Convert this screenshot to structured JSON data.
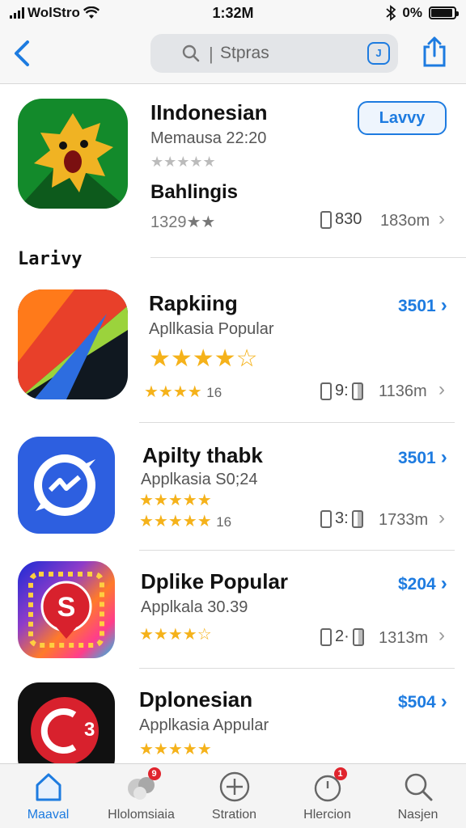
{
  "status_bar": {
    "carrier": "WolStro",
    "time": "1:32M",
    "battery": "0%",
    "battery_level": 0.92
  },
  "nav": {
    "search_text": "Stpras",
    "search_sep": "|",
    "clip_label": "J"
  },
  "featured": {
    "name": "IIndonesian",
    "subtitle": "Memausa 22:20",
    "stars": "★★★★★",
    "get_label": "Lavvy",
    "secondary_name": "Bahlingis",
    "rating": "1329★★",
    "count": "830",
    "size": "183om",
    "accent": "#1d7be0"
  },
  "section_title": "Larivy",
  "apps": [
    {
      "name": "Rapkiing",
      "subtitle": "Apllkasia Popular",
      "big_stars": "★★★★☆",
      "small_stars": "★★★★",
      "rating_count": "16",
      "count": "9:",
      "size": "1136m",
      "price": "3501"
    },
    {
      "name": "Apilty thabk",
      "subtitle": "Applkasia S0;24",
      "big_stars": "★★★★★",
      "small_stars": "★★★★★",
      "rating_count": "16",
      "count": "3:",
      "size": "1733m",
      "price": "3501"
    },
    {
      "name": "Dplike Popular",
      "subtitle": "Applkala 30.39",
      "big_stars": "",
      "small_stars": "★★★★☆",
      "rating_count": "",
      "count": "2·",
      "size": "1313m",
      "price": "$204"
    },
    {
      "name": "Dplonesian",
      "subtitle": "Applkasia Appular",
      "big_stars": "",
      "small_stars": "★★★★★",
      "rating_count": "",
      "count": "",
      "size": "",
      "price": "$504"
    }
  ],
  "tabs": [
    {
      "label": "Maaval",
      "icon": "home-icon",
      "active": true
    },
    {
      "label": "Hlolomsiaia",
      "icon": "avatars-icon",
      "badge": "9"
    },
    {
      "label": "Stration",
      "icon": "plus-circle-icon"
    },
    {
      "label": "Hlercion",
      "icon": "timer-icon",
      "badge": "1"
    },
    {
      "label": "Nasjen",
      "icon": "search-icon"
    }
  ]
}
